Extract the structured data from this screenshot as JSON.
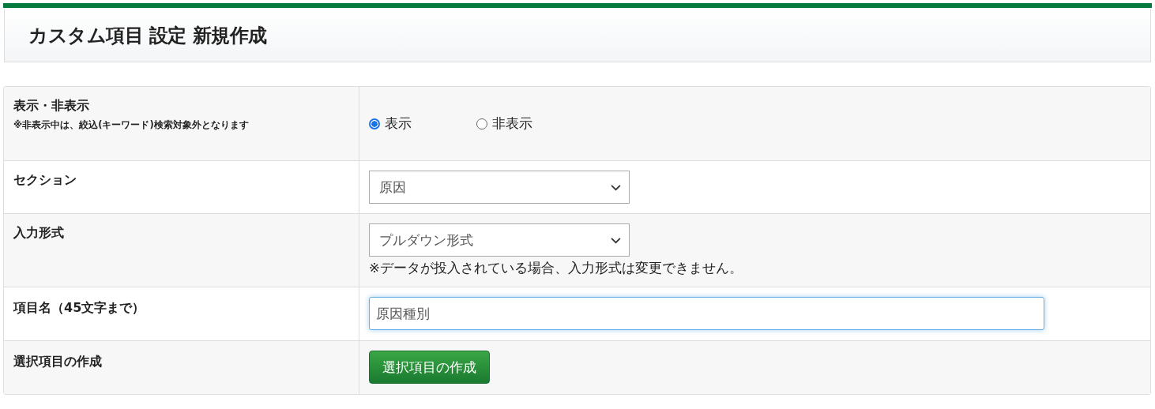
{
  "page": {
    "title": "カスタム項目 設定 新規作成"
  },
  "form": {
    "rows": [
      {
        "kind": "radio",
        "label": "表示・非表示",
        "note": "※非表示中は、絞込(キーワード)検索対象外となります",
        "options": [
          {
            "label": "表示",
            "selected": true
          },
          {
            "label": "非表示",
            "selected": false
          }
        ]
      },
      {
        "kind": "select",
        "label": "セクション",
        "value": "原因"
      },
      {
        "kind": "select",
        "label": "入力形式",
        "value": "プルダウン形式",
        "help": "※データが投入されている場合、入力形式は変更できません。"
      },
      {
        "kind": "text",
        "label": "項目名（45文字まで）",
        "value": "原因種別",
        "focused": true
      },
      {
        "kind": "button",
        "label": "選択項目の作成",
        "button": "選択項目の作成"
      }
    ]
  }
}
